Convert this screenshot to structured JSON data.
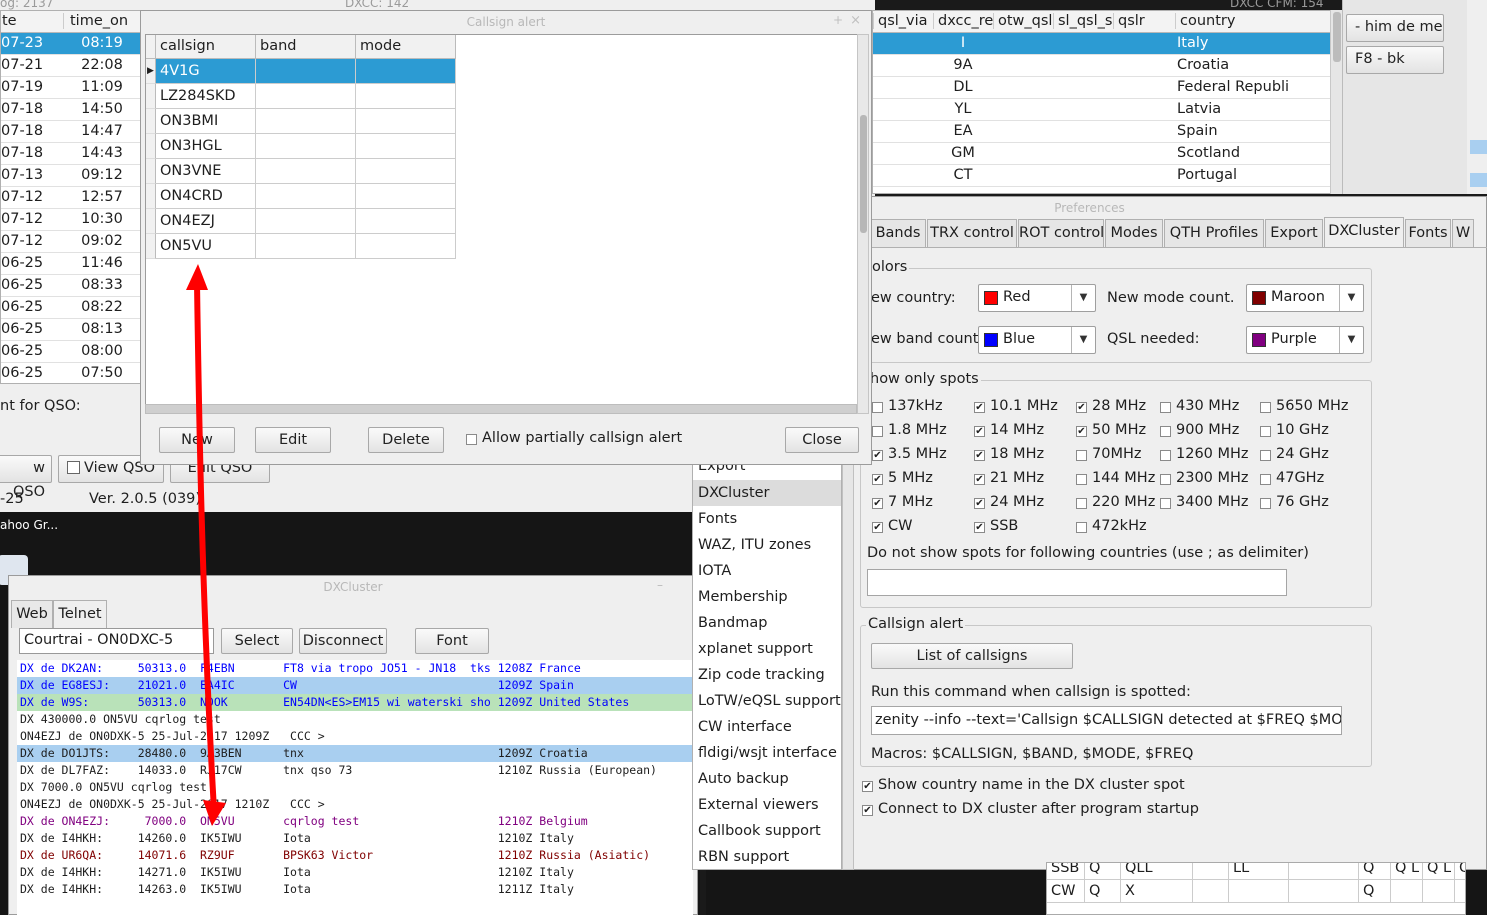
{
  "log_table": {
    "headers": [
      "te",
      "time_on"
    ],
    "head_prefix": "og: 2137",
    "dates": [
      "07-23",
      "07-21",
      "07-19",
      "07-18",
      "07-18",
      "07-18",
      "07-13",
      "07-12",
      "07-12",
      "07-12",
      "06-25",
      "06-25",
      "06-25",
      "06-25",
      "06-25",
      "06-25"
    ],
    "times": [
      "08:19",
      "22:08",
      "11:09",
      "14:50",
      "14:47",
      "14:43",
      "09:12",
      "12:57",
      "10:30",
      "09:02",
      "11:46",
      "08:33",
      "08:22",
      "08:13",
      "08:00",
      "07:50"
    ],
    "right_headers": [
      "qsl_via",
      "dxcc_ref",
      "otw_qsl",
      "sl_qsl_se",
      "qslr",
      "country"
    ],
    "dxcc_refs": [
      "I",
      "9A",
      "DL",
      "YL",
      "EA",
      "GM",
      "CT"
    ],
    "countries": [
      "Italy",
      "Croatia",
      "Federal Republi",
      "Latvia",
      "Spain",
      "Scotland",
      "Portugal"
    ],
    "top_right_title": "DXCC CFM: 154",
    "top_center_title": "DXCC: 142",
    "hint_label": "nt for QSO:",
    "add_qso": "w QSO",
    "view_qso": "View QSO",
    "edit_qso": "Edit QSO",
    "date_label": "-25",
    "version": "Ver. 2.0.5 (039)",
    "yahoo": "ahoo Gr..."
  },
  "macros": [
    "- him de me",
    "F8 - bk"
  ],
  "callsign_alert": {
    "title": "Callsign alert",
    "columns": [
      "callsign",
      "band",
      "mode"
    ],
    "rows": [
      "4V1G",
      "LZ284SKD",
      "ON3BMI",
      "ON3HGL",
      "ON3VNE",
      "ON4CRD",
      "ON4EZJ",
      "ON5VU"
    ],
    "buttons": {
      "new": "New",
      "edit": "Edit",
      "delete": "Delete",
      "close": "Close"
    },
    "allow_partial": "Allow partially callsign alert"
  },
  "preferences": {
    "title": "Preferences",
    "tabs": [
      "Bands",
      "TRX control",
      "ROT control",
      "Modes",
      "QTH Profiles",
      "Export",
      "DXCluster",
      "Fonts",
      "W"
    ],
    "active_tab": "DXCluster",
    "colors_group": "olors",
    "new_country_label": "ew country:",
    "new_country_value": "Red",
    "new_country_color": "#ff0000",
    "new_mode_label": "New mode count.",
    "new_mode_value": "Maroon",
    "new_mode_color": "#800000",
    "new_band_label": "ew band count",
    "new_band_value": "Blue",
    "new_band_color": "#0000ff",
    "qsl_needed_label": "QSL needed:",
    "qsl_needed_value": "Purple",
    "qsl_needed_color": "#800080",
    "spots_group": "how only spots",
    "spots": [
      {
        "label": "137kHz",
        "checked": false
      },
      {
        "label": "10.1 MHz",
        "checked": true
      },
      {
        "label": "28 MHz",
        "checked": true
      },
      {
        "label": "430 MHz",
        "checked": false
      },
      {
        "label": "5650 MHz",
        "checked": false
      },
      {
        "label": "1.8 MHz",
        "checked": false
      },
      {
        "label": "14 MHz",
        "checked": true
      },
      {
        "label": "50 MHz",
        "checked": true
      },
      {
        "label": "900 MHz",
        "checked": false
      },
      {
        "label": "10 GHz",
        "checked": false
      },
      {
        "label": "3.5 MHz",
        "checked": true
      },
      {
        "label": "18 MHz",
        "checked": true
      },
      {
        "label": "70MHz",
        "checked": false
      },
      {
        "label": "1260 MHz",
        "checked": false
      },
      {
        "label": "24 GHz",
        "checked": false
      },
      {
        "label": "5 MHz",
        "checked": true
      },
      {
        "label": "21 MHz",
        "checked": true
      },
      {
        "label": "144 MHz",
        "checked": false
      },
      {
        "label": "2300 MHz",
        "checked": false
      },
      {
        "label": "47GHz",
        "checked": false
      },
      {
        "label": "7 MHz",
        "checked": true
      },
      {
        "label": "24 MHz",
        "checked": true
      },
      {
        "label": "220 MHz",
        "checked": false
      },
      {
        "label": "3400 MHz",
        "checked": false
      },
      {
        "label": "76 GHz",
        "checked": false
      },
      {
        "label": "CW",
        "checked": true
      },
      {
        "label": "SSB",
        "checked": true
      },
      {
        "label": "472kHz",
        "checked": false
      }
    ],
    "no_spots_label": "Do not show spots for following countries (use ; as delimiter)",
    "no_spots_value": "",
    "callsign_alert_group": "Callsign alert",
    "list_button": "List of callsigns",
    "run_command_label": "Run this command when callsign is spotted:",
    "run_command_value": "zenity --info --text='Callsign $CALLSIGN detected at $FREQ $MODE'",
    "macros_label": "Macros: $CALLSIGN, $BAND, $MODE, $FREQ",
    "show_country_label": "Show country name in the DX cluster spot",
    "show_country_checked": true,
    "connect_label": "Connect to DX cluster after program startup",
    "connect_checked": true
  },
  "pref_menu": {
    "partial_top": "Export",
    "items": [
      "DXCluster",
      "Fonts",
      "WAZ, ITU zones",
      "IOTA",
      "Membership",
      "Bandmap",
      "xplanet support",
      "Zip code tracking",
      "LoTW/eQSL support",
      "CW interface",
      "fldigi/wsjt interface",
      "Auto backup",
      "External viewers",
      "Callbook support",
      "RBN support"
    ],
    "selected": "DXCluster"
  },
  "dxcluster": {
    "title": "DXCluster",
    "tabs": [
      "Web",
      "Telnet"
    ],
    "active_tab": "Telnet",
    "server": "Courtrai - ON0DXC-5",
    "buttons": {
      "select": "Select",
      "disconnect": "Disconnect",
      "font": "Font"
    },
    "lines": [
      {
        "text": "DX de DK2AN:     50313.0  F4EBN       FT8 via tropo JO51 - JN18  tks 1208Z France",
        "color": "#0000ff",
        "bg": ""
      },
      {
        "text": "DX de EG8ESJ:    21021.0  EA4IC       CW                             1209Z Spain",
        "color": "#0000ff",
        "bg": "#a9cff0"
      },
      {
        "text": "DX de W9S:       50313.0  N0OK        EN54DN<ES>EM15 wi waterski sho 1209Z United States",
        "color": "#0000ff",
        "bg": "#b9e2b9"
      },
      {
        "text": "DX 430000.0 ON5VU cqrlog test",
        "color": "#1e1e1e",
        "bg": ""
      },
      {
        "text": "ON4EZJ de ON0DXK-5 25-Jul-2017 1209Z   CCC >",
        "color": "#1e1e1e",
        "bg": ""
      },
      {
        "text": "DX de DO1JTS:    28480.0  9A3BEN      tnx                            1209Z Croatia",
        "color": "#1e1e1e",
        "bg": "#a9cff0"
      },
      {
        "text": "DX de DL7FAZ:    14033.0  RJ17CW      tnx qso 73                     1210Z Russia (European)",
        "color": "#1e1e1e",
        "bg": ""
      },
      {
        "text": "DX 7000.0 ON5VU cqrlog test",
        "color": "#1e1e1e",
        "bg": ""
      },
      {
        "text": "ON4EZJ de ON0DXK-5 25-Jul-2017 1210Z   CCC >",
        "color": "#1e1e1e",
        "bg": ""
      },
      {
        "text": "DX de ON4EZJ:     7000.0  ON5VU       cqrlog test                    1210Z Belgium",
        "color": "#800080",
        "bg": ""
      },
      {
        "text": "DX de I4HKH:     14260.0  IK5IWU      Iota                           1210Z Italy",
        "color": "#1e1e1e",
        "bg": ""
      },
      {
        "text": "DX de UR6QA:     14071.6  RZ9UF       BPSK63 Victor                  1210Z Russia (Asiatic)",
        "color": "#800000",
        "bg": ""
      },
      {
        "text": "DX de I4HKH:     14271.0  IK5IWU      Iota                           1210Z Italy",
        "color": "#1e1e1e",
        "bg": ""
      },
      {
        "text": "DX de I4HKH:     14263.0  IK5IWU      Iota                           1211Z Italy",
        "color": "#1e1e1e",
        "bg": ""
      }
    ]
  },
  "bottom_table": {
    "rows": [
      [
        "SSB",
        "Q",
        "QLL",
        "",
        "LL",
        "",
        "Q",
        "Q L",
        "Q L",
        "QLL"
      ],
      [
        "CW",
        "Q",
        "X",
        "",
        "",
        "",
        "Q",
        "",
        "",
        ""
      ]
    ]
  }
}
